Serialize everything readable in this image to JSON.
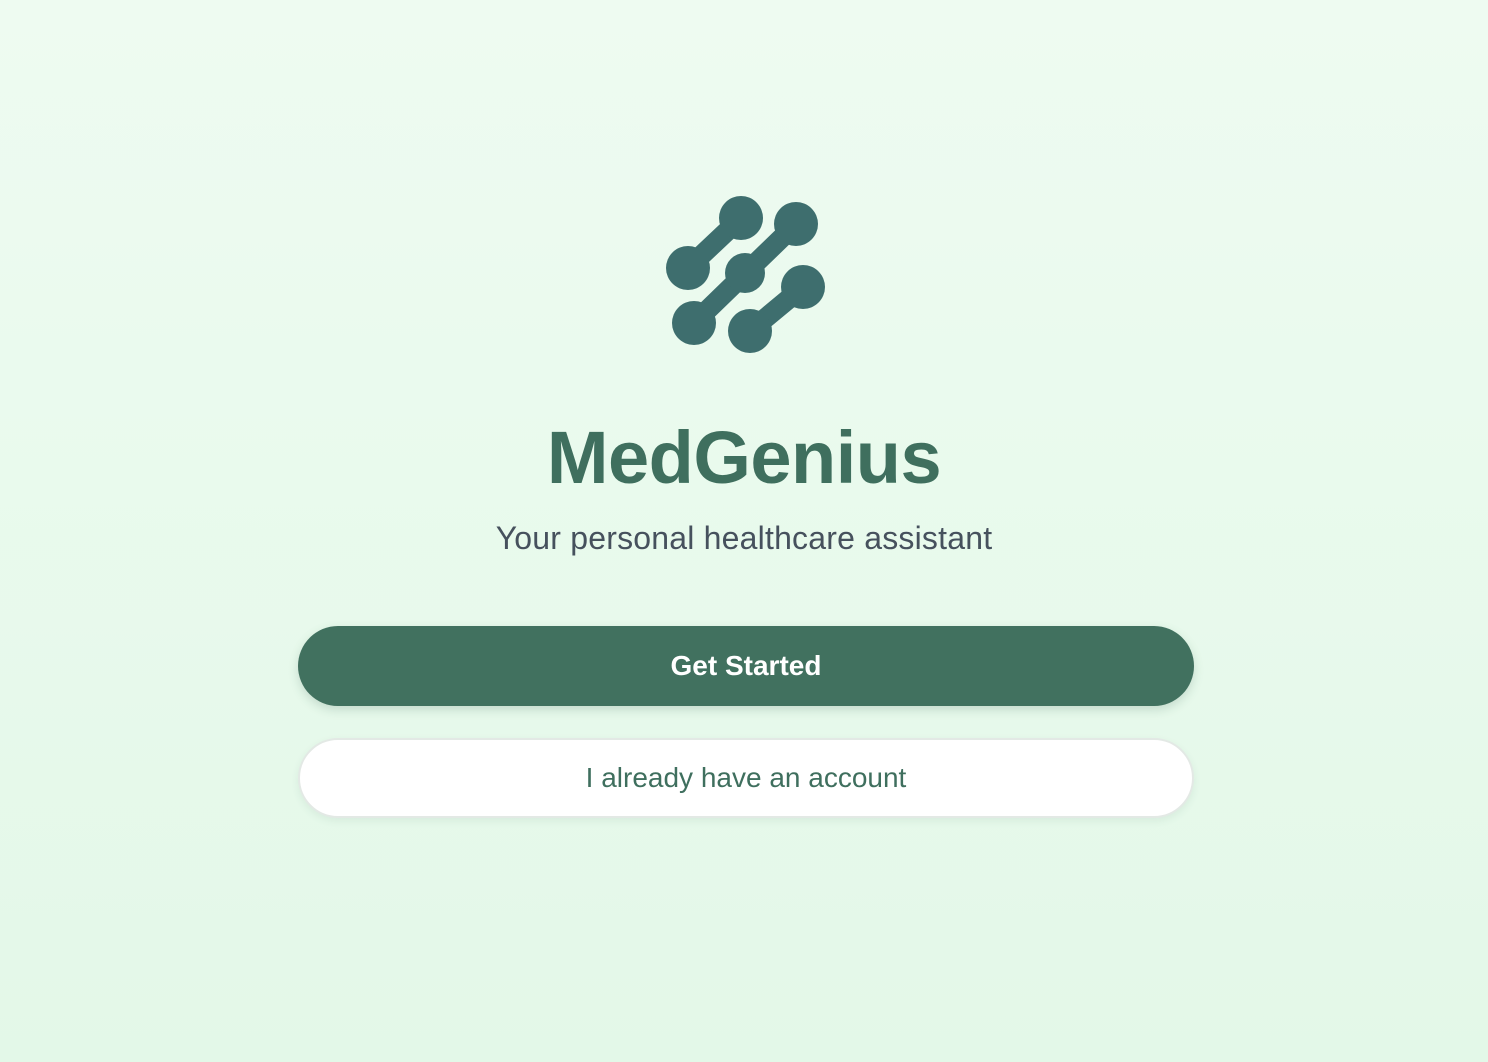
{
  "app": {
    "name": "MedGenius",
    "tagline": "Your personal healthcare assistant",
    "logo_icon": "molecule-links-icon",
    "brand_color": "#41715f",
    "logo_color": "#3e6e6e"
  },
  "actions": {
    "primary_label": "Get Started",
    "secondary_label": "I already have an account"
  }
}
